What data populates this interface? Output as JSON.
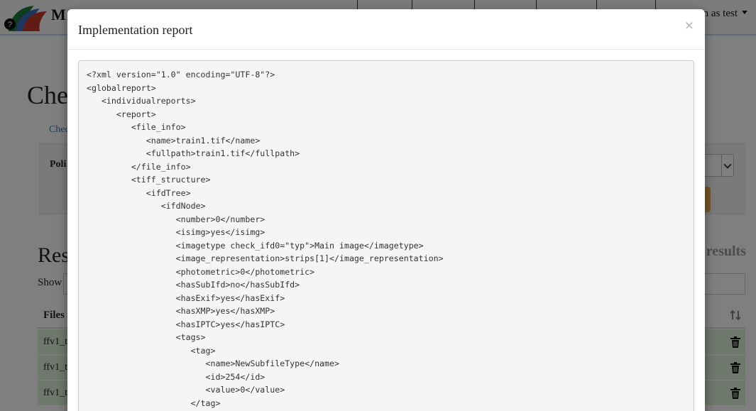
{
  "app": {
    "brand": "M",
    "user_menu": "n as test"
  },
  "page": {
    "title": "Che",
    "tab_label": "Chec",
    "policy_label": "Poli"
  },
  "results": {
    "title": "Res",
    "right_title": "results",
    "show_label": "Show",
    "column_files": "Files"
  },
  "rows": [
    "ffv1_t",
    "ffv1_t",
    "ffv1_t"
  ],
  "colors": {
    "row_green": "#dff0d8",
    "button_orange": "#f0ad4e",
    "link_blue": "#337ab7"
  },
  "icons": {
    "close": "close-icon",
    "trash": "trash-icon",
    "sort": "sort-icon",
    "logo": "logo-icon"
  },
  "modal": {
    "title": "Implementation report",
    "close_label": "×",
    "xml_lines": [
      "<?xml version=\"1.0\" encoding=\"UTF-8\"?>",
      "<globalreport>",
      "   <individualreports>",
      "      <report>",
      "         <file_info>",
      "            <name>train1.tif</name>",
      "            <fullpath>train1.tif</fullpath>",
      "         </file_info>",
      "         <tiff_structure>",
      "            <ifdTree>",
      "               <ifdNode>",
      "                  <number>0</number>",
      "                  <isimg>yes</isimg>",
      "                  <imagetype check_ifd0=\"typ\">Main image</imagetype>",
      "                  <image_representation>strips[1]</image_representation>",
      "                  <photometric>0</photometric>",
      "                  <hasSubIfd>no</hasSubIfd>",
      "                  <hasExif>yes</hasExif>",
      "                  <hasXMP>yes</hasXMP>",
      "                  <hasIPTC>yes</hasIPTC>",
      "                  <tags>",
      "                     <tag>",
      "                        <name>NewSubfileType</name>",
      "                        <id>254</id>",
      "                        <value>0</value>",
      "                     </tag>"
    ]
  }
}
